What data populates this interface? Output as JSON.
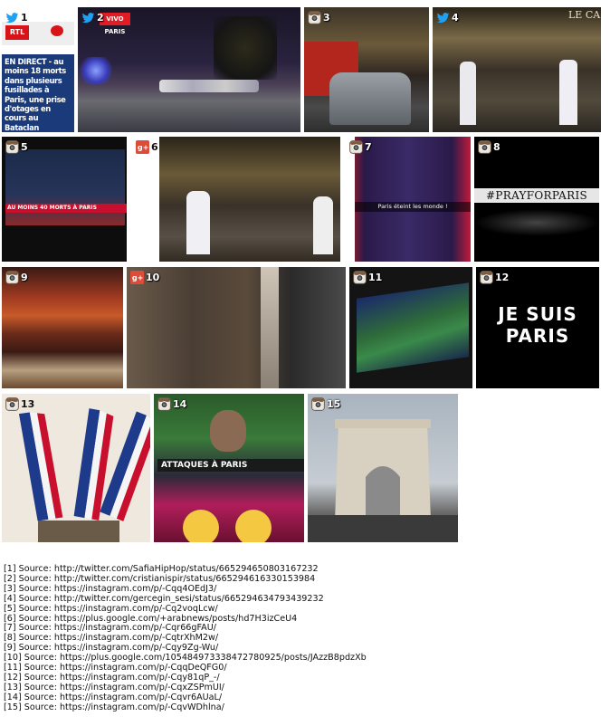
{
  "tiles": [
    {
      "n": "1",
      "icon": "twitter-icon",
      "phone_header": "RTL",
      "phone_headline": "EN DIRECT - au moins 18 morts dans plusieurs fusillades à Paris, une prise d'otages en cours au Bataclan"
    },
    {
      "n": "2",
      "icon": "twitter-icon",
      "logo": "VIVO PARIS"
    },
    {
      "n": "3",
      "icon": "instagram-icon"
    },
    {
      "n": "4",
      "icon": "instagram-icon",
      "storefront": "LE CA"
    },
    {
      "n": "5",
      "icon": "instagram-icon",
      "ticker": "AU MOINS 40 MORTS À PARIS"
    },
    {
      "n": "6",
      "icon": "googleplus-icon"
    },
    {
      "n": "7",
      "icon": "instagram-icon",
      "caption": "Paris éteint les monde !"
    },
    {
      "n": "8",
      "icon": "instagram-icon",
      "hashtag": "#PRAYFORPARIS"
    },
    {
      "n": "9",
      "icon": "instagram-icon"
    },
    {
      "n": "10",
      "icon": "googleplus-icon"
    },
    {
      "n": "11",
      "icon": "instagram-icon"
    },
    {
      "n": "12",
      "icon": "instagram-icon",
      "line1": "JE SUIS",
      "line2": "PARIS"
    },
    {
      "n": "13",
      "icon": "instagram-icon"
    },
    {
      "n": "14",
      "icon": "instagram-icon",
      "banner": "ATTAQUES À PARIS"
    },
    {
      "n": "15",
      "icon": "instagram-icon"
    }
  ],
  "sources": [
    "[1] Source: http://twitter.com/SafiaHipHop/status/665294650803167232",
    "[2] Source: http://twitter.com/cristianispir/status/665294616330153984",
    "[3] Source: https://instagram.com/p/-Cqq4OEdJ3/",
    "[4] Source: http://twitter.com/gercegin_sesi/status/665294634793439232",
    "[5] Source: https://instagram.com/p/-Cq2voqLcw/",
    "[6] Source: https://plus.google.com/+arabnews/posts/hd7H3izCeU4",
    "[7] Source: https://instagram.com/p/-Cqr66gFAU/",
    "[8] Source: https://instagram.com/p/-CqtrXhM2w/",
    "[9] Source: https://instagram.com/p/-Cqy9Zg-Wu/",
    "[10] Source: https://plus.google.com/105484973338472780925/posts/JAzzB8pdzXb",
    "[11] Source: https://instagram.com/p/-CqqDeQFG0/",
    "[12] Source: https://instagram.com/p/-Cqy81qP_-/",
    "[13] Source: https://instagram.com/p/-CqxZSPmUI/",
    "[14] Source: https://instagram.com/p/-Cqvr6AUaL/",
    "[15] Source: https://instagram.com/p/-CqvWDhlna/"
  ],
  "colors": {
    "twitter": "#1da1f2",
    "googleplus": "#dd4b39",
    "rtl_red": "#d7141a"
  }
}
